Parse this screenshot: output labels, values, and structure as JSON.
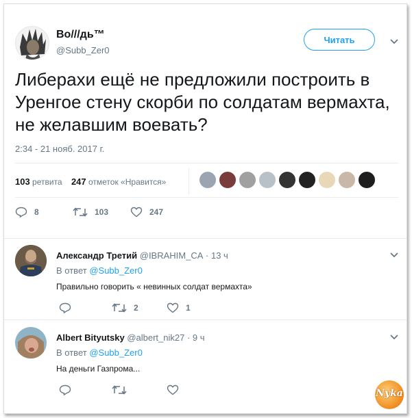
{
  "tweet": {
    "author_name": "Во///дь™",
    "author_handle": "@Subb_Zer0",
    "follow_label": "Читать",
    "text": "Либерахи ещё не предложили построить в Уренгое стену скорби по солдатам вермахта, не желавшим воевать?",
    "timestamp": "2:34 - 21 нояб. 2017 г.",
    "retweets_count": "103",
    "retweets_label": "ретвита",
    "likes_count": "247",
    "likes_label": "отметок «Нравится»",
    "actions": {
      "reply": "8",
      "retweet": "103",
      "like": "247"
    }
  },
  "replies": [
    {
      "name": "Александр Третий",
      "handle": "@IBRAHIM_CA",
      "time": "· 13 ч",
      "in_reply_prefix": "В ответ",
      "in_reply_mention": "@Subb_Zer0",
      "text": "Правильно говорить « невинных солдат вермахта»",
      "actions": {
        "reply": "",
        "retweet": "2",
        "like": "1"
      }
    },
    {
      "name": "Albert Bityutsky",
      "handle": "@albert_nik27",
      "time": "· 9 ч",
      "in_reply_prefix": "В ответ",
      "in_reply_mention": "@Subb_Zer0",
      "text": "На деньги Газпрома...",
      "actions": {
        "reply": "",
        "retweet": "",
        "like": ""
      }
    }
  ],
  "watermark": "Nyka",
  "colors": {
    "accent": "#1da1f2",
    "secondary_text": "#657786",
    "divider": "#e6ecf0"
  }
}
